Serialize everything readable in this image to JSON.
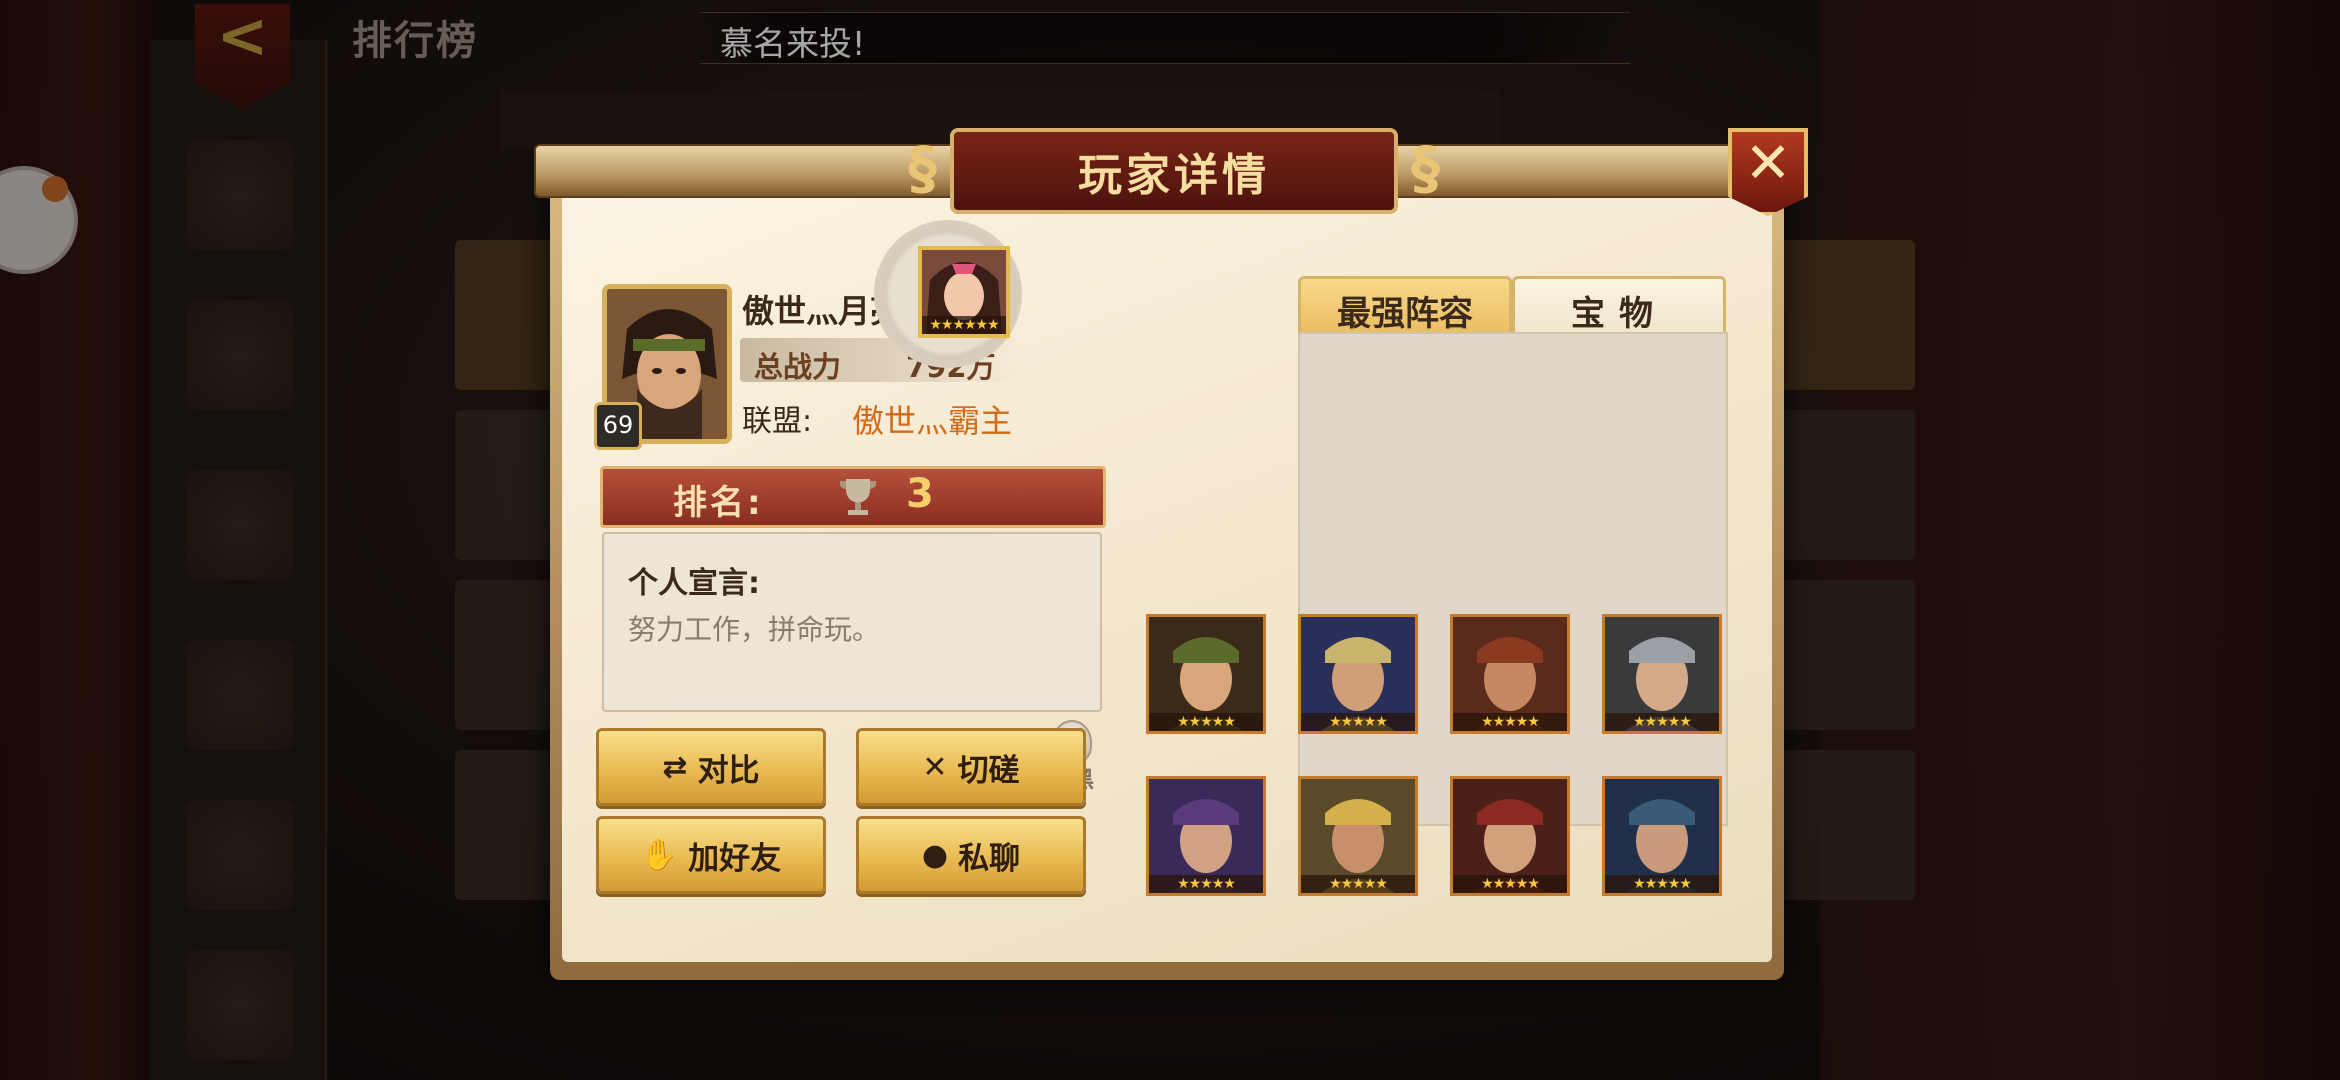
{
  "header": {
    "back_glyph": "<",
    "title": "排行榜",
    "marquee": "慕名来投!"
  },
  "modal": {
    "title": "玩家详情",
    "close_glyph": "✕",
    "player": {
      "name": "傲世灬月亮",
      "level": "69",
      "power_label": "总战力",
      "power_value": "792万",
      "alliance_label": "联盟:",
      "alliance_value": "傲世灬霸主"
    },
    "rank": {
      "label": "排名:",
      "value": "3"
    },
    "motto": {
      "title": "个人宣言:",
      "text": "努力工作，拼命玩。"
    },
    "block_label": "拉黑",
    "buttons": {
      "compare": "对比",
      "spar": "切磋",
      "add_friend": "加好友",
      "private_chat": "私聊"
    },
    "tabs": {
      "lineup": "最强阵容",
      "treasure": "宝物"
    },
    "stars": "★★★★★",
    "feature_stars": "★★★★★★"
  },
  "colors": {
    "accent_gold": "#e9ba52",
    "title_red": "#7a2416",
    "alliance_orange": "#d26b1a"
  }
}
